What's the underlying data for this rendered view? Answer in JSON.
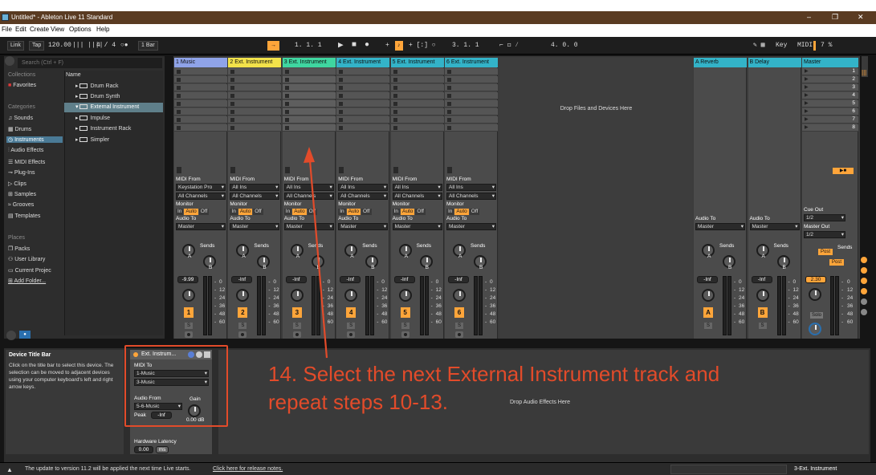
{
  "window": {
    "title": "Untitled* - Ableton Live 11 Standard",
    "minimize": "–",
    "maximize": "❐",
    "close": "✕"
  },
  "menu": [
    "File",
    "Edit",
    "Create",
    "View",
    "Options",
    "Help"
  ],
  "transport": {
    "link": "Link",
    "tap": "Tap",
    "tempo": "120.00",
    "nudge": "|||  ||||",
    "time_sig": "4 / 4",
    "metronome": "○●",
    "quantize": "1 Bar",
    "arrangement_position": "1.   1.   1",
    "loop_start": "3.   1.   1",
    "loop_length": "4.   0.   0",
    "key": "Key",
    "midi": "MIDI",
    "cpu": "7 %"
  },
  "browser": {
    "search_placeholder": "Search (Ctrl + F)",
    "collections_header": "Collections",
    "favorites": "Favorites",
    "categories_header": "Categories",
    "categories": [
      "Sounds",
      "Drums",
      "Instruments",
      "Audio Effects",
      "MIDI Effects",
      "Plug-Ins",
      "Clips",
      "Samples",
      "Grooves",
      "Templates"
    ],
    "places_header": "Places",
    "places": [
      "Packs",
      "User Library",
      "Current Projec",
      "Add Folder..."
    ],
    "name_header": "Name",
    "items": [
      "Drum Rack",
      "Drum Synth",
      "External Instrument",
      "Impulse",
      "Instrument Rack",
      "Simpler"
    ]
  },
  "tracks": [
    {
      "name": "1 Music",
      "color": "#8fa3e8",
      "midi_from": "Keystation Pro",
      "audio_to": "Master",
      "volume": "-9.99",
      "number": "1"
    },
    {
      "name": "2 Ext. Instrument",
      "color": "#f2e24a",
      "midi_from": "All Ins",
      "audio_to": "Master",
      "volume": "-Inf",
      "number": "2"
    },
    {
      "name": "3 Ext. Instrument",
      "color": "#3fd6a0",
      "midi_from": "All Ins",
      "audio_to": "Master",
      "volume": "-Inf",
      "number": "3"
    },
    {
      "name": "4 Ext. Instrument",
      "color": "#33b3c8",
      "midi_from": "All Ins",
      "audio_to": "Master",
      "volume": "-Inf",
      "number": "4"
    },
    {
      "name": "5 Ext. Instrument",
      "color": "#33b3c8",
      "midi_from": "All Ins",
      "audio_to": "Master",
      "volume": "-Inf",
      "number": "5"
    },
    {
      "name": "6 Ext. Instrument",
      "color": "#33b3c8",
      "midi_from": "All Ins",
      "audio_to": "Master",
      "volume": "-Inf",
      "number": "6"
    }
  ],
  "track_labels": {
    "midi_from": "MIDI From",
    "all_channels": "All Channels",
    "monitor": "Monitor",
    "mon_in": "In",
    "mon_auto": "Auto",
    "mon_off": "Off",
    "audio_to": "Audio To",
    "sends": "Sends",
    "send_a": "A",
    "send_b": "B",
    "solo": "S",
    "meter_scale": "0\n12\n24\n36\n48\n60",
    "meter_scale_sign": "-\n-\n-\n-\n-\n-"
  },
  "drop_area": "Drop Files and Devices Here",
  "returns": [
    {
      "name": "A Reverb",
      "color": "#33b3c8",
      "audio_to": "Master",
      "volume": "-Inf",
      "letter": "A"
    },
    {
      "name": "B Delay",
      "color": "#33b3c8",
      "audio_to": "Master",
      "volume": "-Inf",
      "letter": "B"
    }
  ],
  "master": {
    "name": "Master",
    "color": "#33b3c8",
    "scenes": [
      "1",
      "2",
      "3",
      "4",
      "5",
      "6",
      "7",
      "8"
    ],
    "cue_out": "Cue Out",
    "cue_value": "1/2",
    "master_out": "Master Out",
    "master_value": "1/2",
    "post": "Post",
    "volume": "2.30",
    "solo": "Solo"
  },
  "info_panel": {
    "title": "Device Title Bar",
    "body": "Click on the title bar to select this device. The selection can be moved to adjacent devices using your computer keyboard's left and right arrow keys."
  },
  "device": {
    "title": "Ext. Instrum...",
    "midi_to": "MIDI To",
    "midi_to_1": "1-Music",
    "midi_to_2": "3-Music",
    "audio_from": "Audio From",
    "audio_from_value": "5-6-Music",
    "gain": "Gain",
    "gain_value": "0.00 dB",
    "peak": "Peak",
    "peak_value": "-Inf",
    "hw_latency": "Hardware Latency",
    "hw_latency_value": "0.00",
    "hw_unit": "ms"
  },
  "drop_fx": "Drop Audio Effects Here",
  "annotation": {
    "line1": "14. Select the next External Instrument track and",
    "line2": "repeat steps 10-13."
  },
  "status": {
    "message": "The update to version 11.2 will be applied the next time Live starts.",
    "link": "Click here for release notes.",
    "selected_track": "3-Ext. Instrument"
  }
}
